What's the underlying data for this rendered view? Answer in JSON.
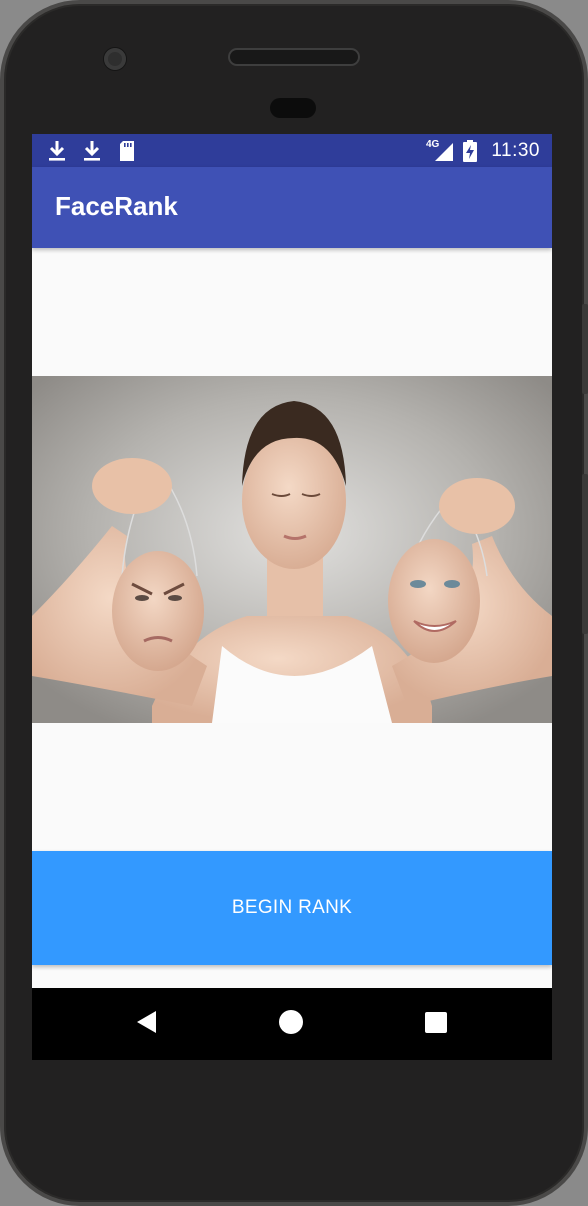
{
  "status_bar": {
    "time": "11:30",
    "network": "4G",
    "left_icons": [
      "download-icon",
      "download-icon",
      "sd-card-icon"
    ],
    "right_icons": [
      "signal-icon",
      "battery-charging-icon"
    ]
  },
  "app_bar": {
    "title": "FaceRank"
  },
  "hero_image": {
    "description": "woman-holding-masks"
  },
  "main": {
    "begin_button_label": "BEGIN RANK"
  },
  "nav_bar": {
    "buttons": [
      "back-icon",
      "home-icon",
      "recents-icon"
    ]
  },
  "colors": {
    "status_bar": "#2f3d9a",
    "app_bar": "#3f51b5",
    "button": "#3399ff",
    "background": "#fafafa"
  }
}
